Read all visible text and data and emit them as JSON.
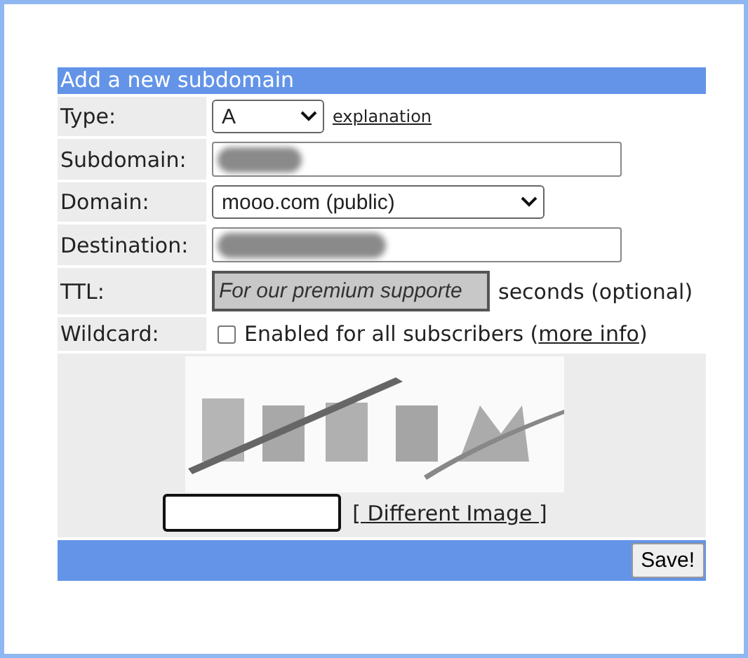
{
  "form": {
    "title": "Add a new subdomain",
    "rows": [
      {
        "kind": "select",
        "label": "Type:",
        "value": "A",
        "link": "explanation"
      },
      {
        "kind": "text",
        "label": "Subdomain:",
        "redacted": true
      },
      {
        "kind": "select",
        "label": "Domain:",
        "value": "mooo.com (public)"
      },
      {
        "kind": "text",
        "label": "Destination:",
        "redacted": true
      },
      {
        "kind": "ttl",
        "label": "TTL:",
        "value": "For our premium supporte",
        "suffix": "seconds (optional)",
        "disabled": true
      },
      {
        "kind": "checkbox",
        "label": "Wildcard:",
        "checked": false,
        "text": "Enabled for all subscribers (",
        "link": "more info",
        "after": ")"
      }
    ],
    "captcha": {
      "link": "[ Different Image ]"
    },
    "save_button": "Save!"
  }
}
